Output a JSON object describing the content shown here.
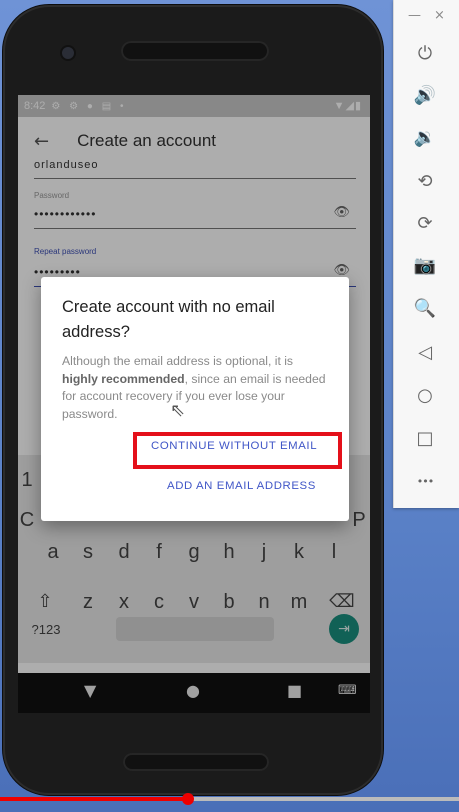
{
  "emulator_toolbar": {
    "minimize_glyph": "—",
    "close_glyph": "×",
    "more_glyph": "•••",
    "tools": [
      {
        "icon": "power-icon",
        "glyph": "⏻"
      },
      {
        "icon": "volume-up-icon",
        "glyph": "🔊"
      },
      {
        "icon": "volume-down-icon",
        "glyph": "🔉"
      },
      {
        "icon": "rotate-left-icon",
        "glyph": "⟲"
      },
      {
        "icon": "rotate-right-icon",
        "glyph": "⟳"
      },
      {
        "icon": "camera-icon",
        "glyph": "📷"
      },
      {
        "icon": "zoom-icon",
        "glyph": "🔍"
      },
      {
        "icon": "back-triangle-icon",
        "glyph": "◁"
      },
      {
        "icon": "home-circle-icon",
        "glyph": "○"
      },
      {
        "icon": "overview-square-icon",
        "glyph": "□"
      }
    ]
  },
  "status_bar": {
    "time": "8:42",
    "icons": "⚙ ⚙ ● ▤ •",
    "right_icons": "▼◢▮"
  },
  "app_bar": {
    "back_glyph": "←",
    "title": "Create an account"
  },
  "form": {
    "username_partial": "orlanduseo",
    "password_label": "Password",
    "password_value": "••••••••••••",
    "repeat_label": "Repeat password",
    "repeat_value": "•••••••••",
    "eye_glyph": "👁"
  },
  "keyboard": {
    "row_side_left": "1",
    "row_side_left2": "C",
    "row_side_right2": "P",
    "row2": [
      "a",
      "s",
      "d",
      "f",
      "g",
      "h",
      "j",
      "k",
      "l"
    ],
    "row3": [
      "⇧",
      "z",
      "x",
      "c",
      "v",
      "b",
      "n",
      "m",
      "⌫"
    ],
    "symbols_key": "?123",
    "enter_glyph": "⇥"
  },
  "nav_bar": {
    "back": "▼",
    "home": "●",
    "recents": "■",
    "keyboard_switch": "⌨"
  },
  "dialog": {
    "title": "Create account with no email address?",
    "body_before": "Although the email address is optional, it is ",
    "body_bold": "highly recommended",
    "body_after": ", since an email is needed for account recovery if you ever lose your password.",
    "continue_label": "CONTINUE WITHOUT EMAIL",
    "add_label": "ADD AN EMAIL ADDRESS"
  },
  "annotation": {
    "highlight_color": "#e4101a"
  },
  "video_progress": {
    "fraction": 0.41,
    "color": "#ee0000"
  }
}
